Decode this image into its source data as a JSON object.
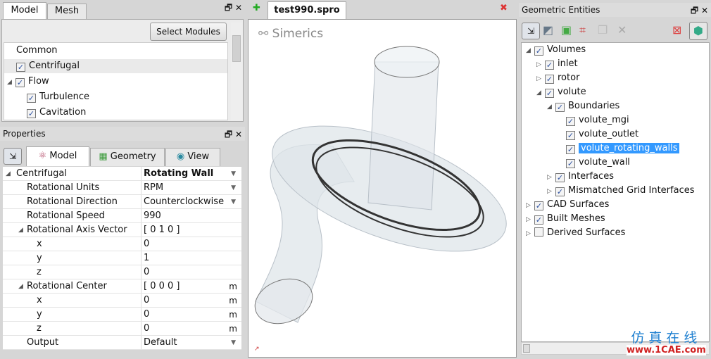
{
  "model_panel": {
    "tabs": [
      "Model",
      "Mesh"
    ],
    "select_modules": "Select Modules",
    "items": [
      {
        "label": "Common",
        "checkbox": false
      },
      {
        "label": "Centrifugal",
        "checkbox": true,
        "checked": true
      },
      {
        "label": "Flow",
        "checkbox": true,
        "checked": true,
        "expanded": true
      },
      {
        "label": "Turbulence",
        "checkbox": true,
        "checked": true
      },
      {
        "label": "Cavitation",
        "checkbox": true,
        "checked": true
      }
    ]
  },
  "properties": {
    "title": "Properties",
    "tabs": [
      "Model",
      "Geometry",
      "View"
    ],
    "rows": [
      {
        "name": "Centrifugal",
        "value": "Rotating Wall",
        "unit": "",
        "dropdown": true,
        "bold": true,
        "level": 0,
        "expander": true
      },
      {
        "name": "Rotational Units",
        "value": "RPM",
        "unit": "",
        "dropdown": true,
        "level": 1
      },
      {
        "name": "Rotational Direction",
        "value": "Counterclockwise",
        "unit": "",
        "dropdown": true,
        "level": 1
      },
      {
        "name": "Rotational Speed",
        "value": "990",
        "unit": "",
        "level": 1
      },
      {
        "name": "Rotational Axis Vector",
        "value": "[ 0 1 0 ]",
        "unit": "",
        "level": 1,
        "expander": true
      },
      {
        "name": "x",
        "value": "0",
        "unit": "",
        "level": 2
      },
      {
        "name": "y",
        "value": "1",
        "unit": "",
        "level": 2
      },
      {
        "name": "z",
        "value": "0",
        "unit": "",
        "level": 2
      },
      {
        "name": "Rotational Center",
        "value": "[ 0 0 0 ]",
        "unit": "m",
        "level": 1,
        "expander": true
      },
      {
        "name": "x",
        "value": "0",
        "unit": "m",
        "level": 2
      },
      {
        "name": "y",
        "value": "0",
        "unit": "m",
        "level": 2
      },
      {
        "name": "z",
        "value": "0",
        "unit": "m",
        "level": 2
      },
      {
        "name": "Output",
        "value": "Default",
        "unit": "",
        "dropdown": true,
        "level": 1
      }
    ]
  },
  "viewport": {
    "tab": "test990.spro",
    "logo": "Simerics"
  },
  "geometric": {
    "title": "Geometric Entities",
    "tree": [
      {
        "label": "Volumes",
        "level": 0,
        "exp": "open",
        "checked": true
      },
      {
        "label": "inlet",
        "level": 1,
        "exp": "closed",
        "checked": true
      },
      {
        "label": "rotor",
        "level": 1,
        "exp": "closed",
        "checked": true
      },
      {
        "label": "volute",
        "level": 1,
        "exp": "open",
        "checked": true
      },
      {
        "label": "Boundaries",
        "level": 2,
        "exp": "open",
        "checked": true
      },
      {
        "label": "volute_mgi",
        "level": 3,
        "exp": "",
        "checked": true
      },
      {
        "label": "volute_outlet",
        "level": 3,
        "exp": "",
        "checked": true
      },
      {
        "label": "volute_rotating_walls",
        "level": 3,
        "exp": "",
        "checked": true,
        "selected": true
      },
      {
        "label": "volute_wall",
        "level": 3,
        "exp": "",
        "checked": true
      },
      {
        "label": "Interfaces",
        "level": 2,
        "exp": "closed",
        "checked": true
      },
      {
        "label": "Mismatched Grid Interfaces",
        "level": 2,
        "exp": "closed",
        "checked": true
      },
      {
        "label": "CAD Surfaces",
        "level": 0,
        "exp": "closed",
        "checked": true
      },
      {
        "label": "Built Meshes",
        "level": 0,
        "exp": "closed",
        "checked": true
      },
      {
        "label": "Derived Surfaces",
        "level": 0,
        "exp": "closed",
        "checked": false
      }
    ]
  },
  "watermark": {
    "cn": "仿真在线",
    "url": "www.1CAE.com"
  },
  "colors": {
    "selection": "#3399ff",
    "accent_watermark": "#1e7fd0",
    "watermark_url": "#d02020"
  }
}
